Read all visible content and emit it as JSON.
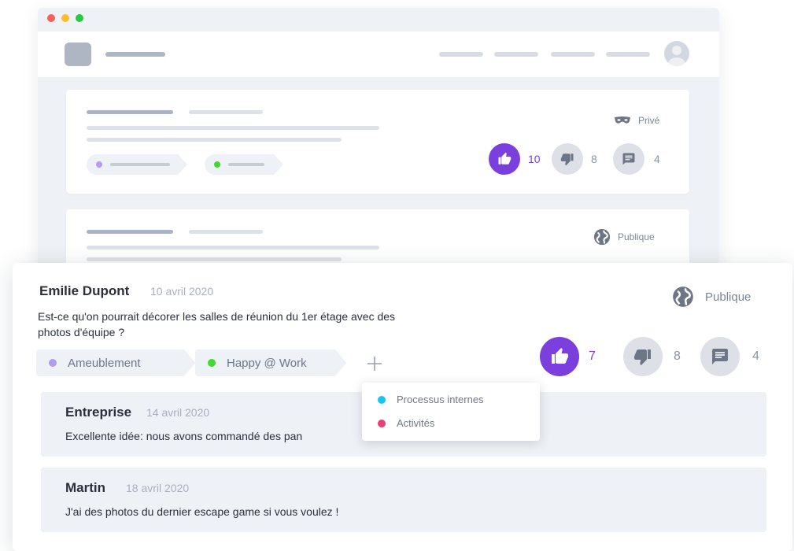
{
  "colors": {
    "accent": "#7a3fdc",
    "window_red": "#fe5f57",
    "window_yellow": "#febc2e",
    "window_green": "#28c840",
    "tag_purple": "#b39bf0",
    "tag_green": "#3ddc2b",
    "tag_cyan": "#16c6f0",
    "tag_pink": "#ee3d74"
  },
  "background_cards": [
    {
      "visibility": {
        "icon": "mask-icon",
        "label": "Privé"
      },
      "votes": {
        "up": "10",
        "down": "8",
        "comments": "4"
      },
      "tag_dot_colors": [
        "#b39bf0",
        "#3ddc2b"
      ]
    },
    {
      "visibility": {
        "icon": "globe-icon",
        "label": "Publique"
      }
    }
  ],
  "post": {
    "author": "Emilie Dupont",
    "date": "10 avril 2020",
    "text": "Est-ce qu'on pourrait décorer les salles de réunion du 1er étage avec des photos d'équipe ?",
    "visibility": {
      "icon": "globe-icon",
      "label": "Publique"
    },
    "tags": [
      {
        "label": "Ameublement",
        "color": "#b39bf0"
      },
      {
        "label": "Happy @ Work",
        "color": "#3ddc2b"
      }
    ],
    "add_tag_icon": "plus-icon",
    "votes": {
      "up": "7",
      "down": "8",
      "comments": "4"
    },
    "tag_dropdown": [
      {
        "label": "Processus internes",
        "color": "#16c6f0"
      },
      {
        "label": "Activités",
        "color": "#ee3d74"
      }
    ],
    "replies": [
      {
        "author": "Entreprise",
        "date": "14 avril 2020",
        "text": "Excellente idée: nous avons commandé des pan"
      },
      {
        "author": "Martin",
        "date": "18 avril 2020",
        "text": "J'ai des photos du dernier escape game si vous voulez !"
      }
    ]
  }
}
